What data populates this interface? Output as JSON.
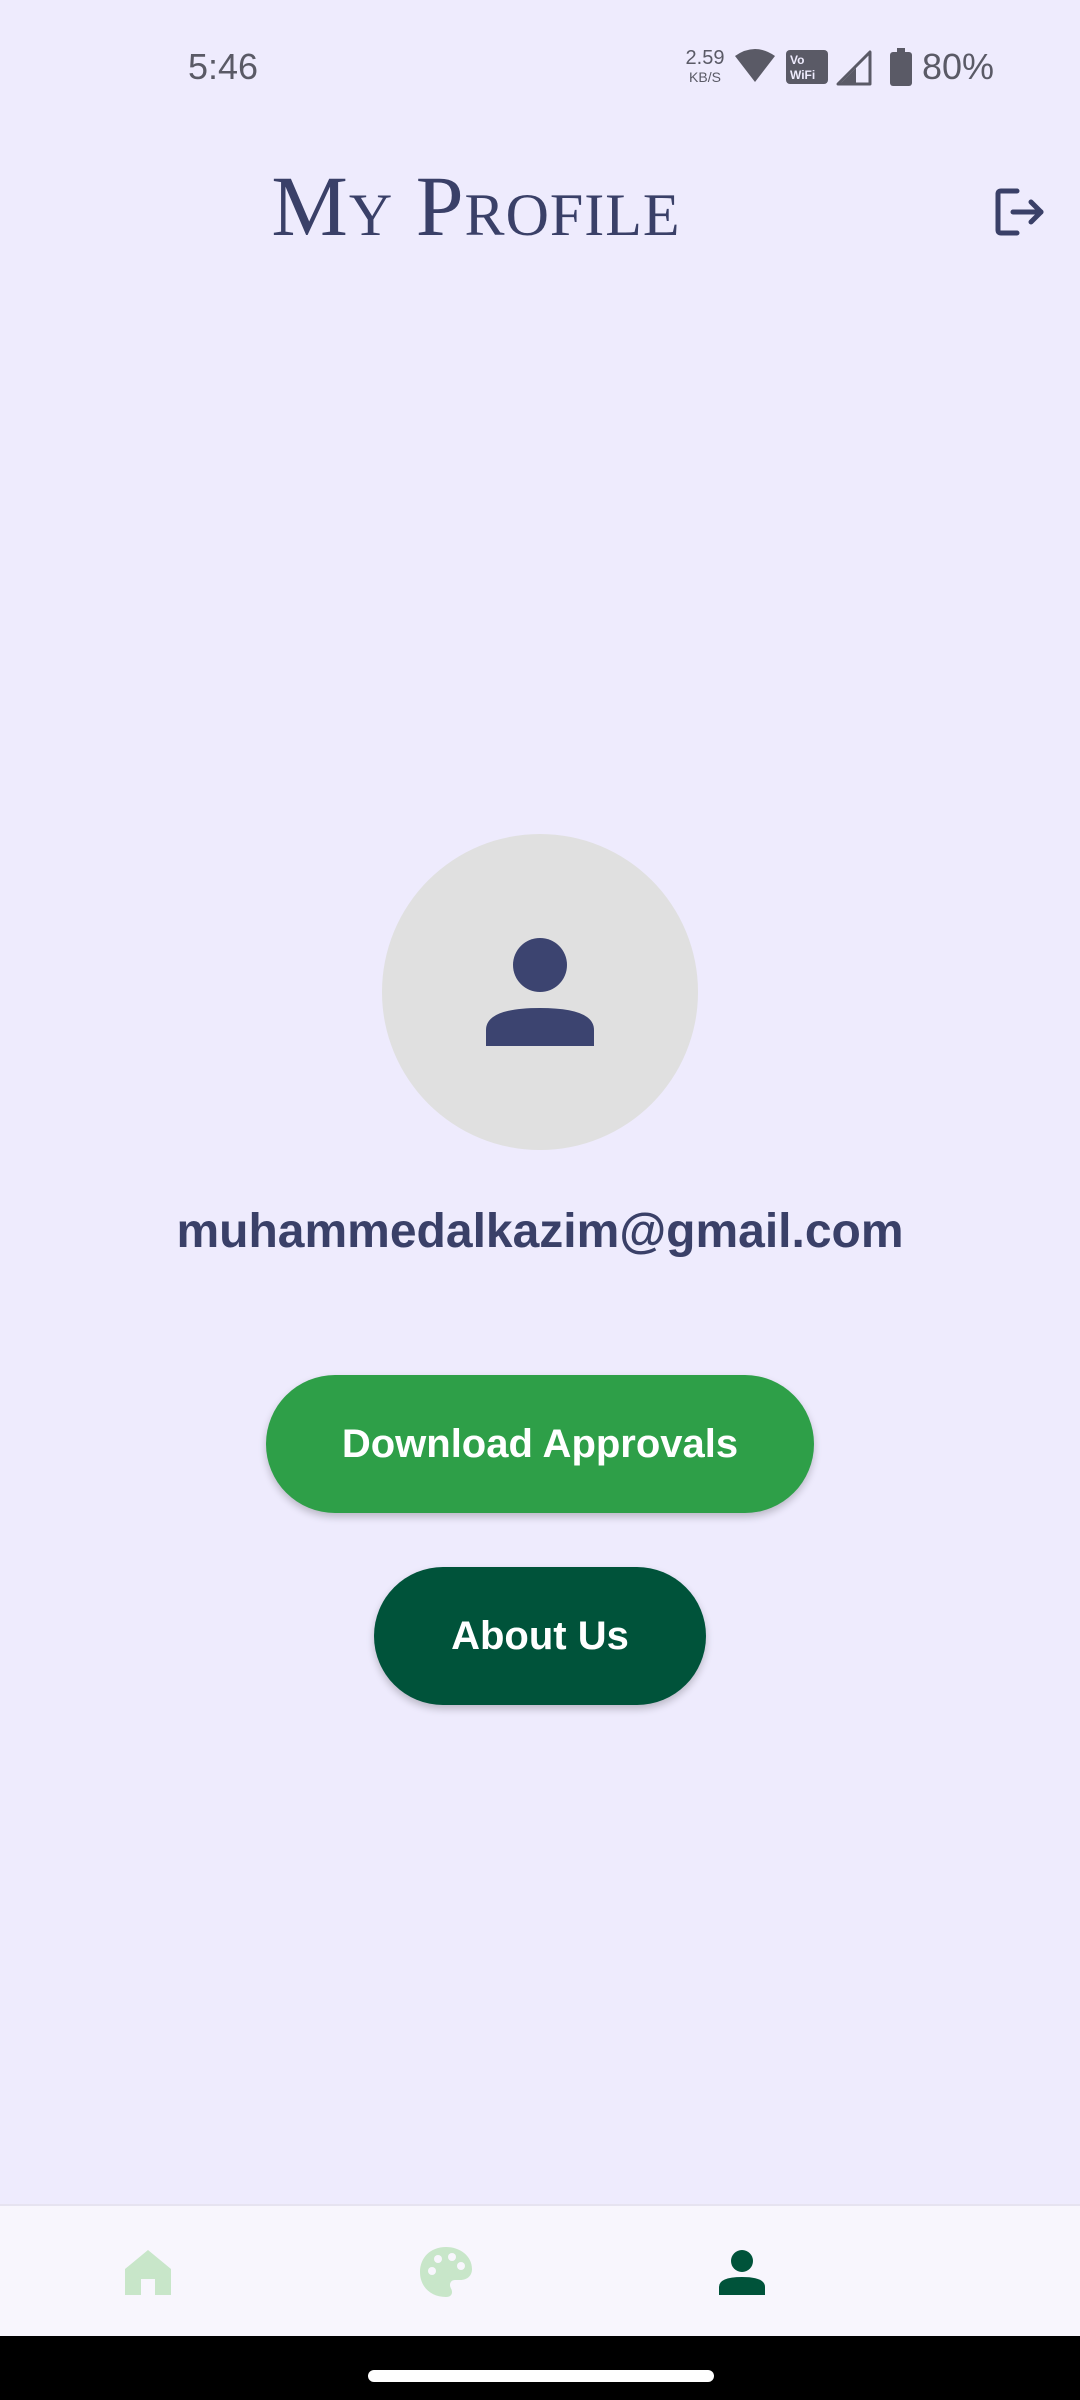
{
  "status_bar": {
    "time": "5:46",
    "net_speed_value": "2.59",
    "net_speed_unit": "KB/S",
    "vowifi_label_top": "Vo",
    "vowifi_label_bottom": "WiFi",
    "battery": "80%",
    "icon_color": "#5a5a66"
  },
  "header": {
    "title": "My Profile",
    "logout_icon": "logout-icon"
  },
  "profile": {
    "avatar_icon": "person-icon",
    "email": "muhammedalkazim@gmail.com"
  },
  "actions": {
    "download_label": "Download Approvals",
    "about_label": "About Us"
  },
  "bottom_nav": {
    "items": [
      {
        "icon": "home-icon",
        "active": false
      },
      {
        "icon": "palette-icon",
        "active": false
      },
      {
        "icon": "person-icon",
        "active": true
      }
    ]
  },
  "colors": {
    "background": "#eeebfd",
    "title": "#3a4068",
    "primary_green": "#2e9f48",
    "dark_green": "#00533a",
    "inactive_nav": "#c8e6c9",
    "avatar_bg": "#e0e0e0"
  }
}
